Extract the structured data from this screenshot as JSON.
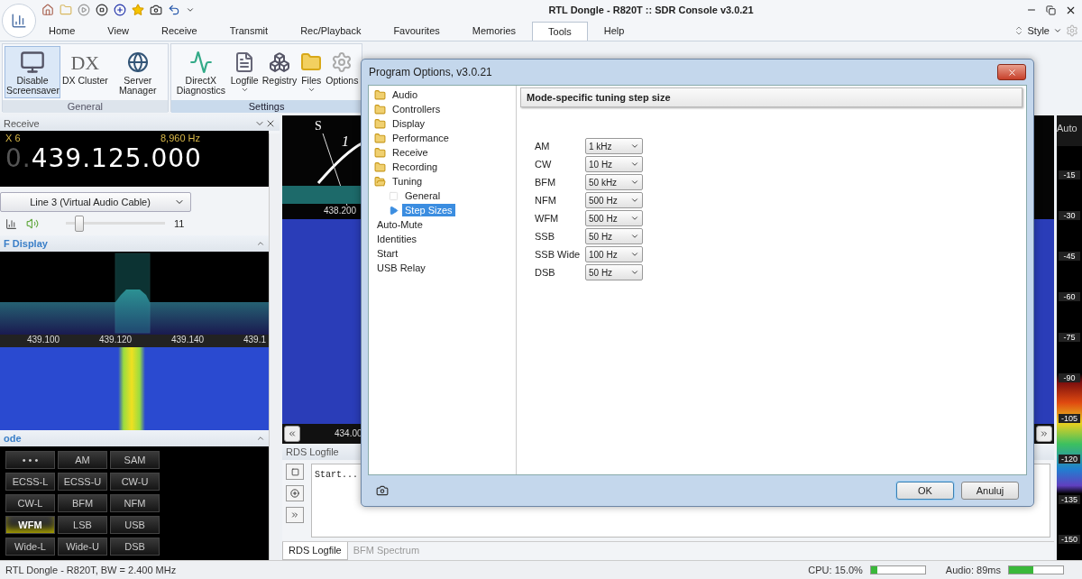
{
  "window": {
    "title": "RTL Dongle - R820T :: SDR Console v3.0.21"
  },
  "ribbon": {
    "tabs": [
      {
        "label": "Home",
        "selected": false
      },
      {
        "label": "View",
        "selected": false
      },
      {
        "label": "Receive",
        "selected": false
      },
      {
        "label": "Transmit",
        "selected": false
      },
      {
        "label": "Rec/Playback",
        "selected": false
      },
      {
        "label": "Favourites",
        "selected": false
      },
      {
        "label": "Memories",
        "selected": false
      },
      {
        "label": "Tools",
        "selected": true
      },
      {
        "label": "Help",
        "selected": false
      }
    ],
    "style_label": "Style",
    "groups": [
      {
        "title": "General",
        "buttons": [
          {
            "kind": "monitor",
            "label": "Disable Screensaver",
            "selected": true,
            "menu": false
          },
          {
            "kind": "glyph",
            "glyph": "DX",
            "label": "DX Cluster",
            "selected": false,
            "menu": false
          },
          {
            "kind": "server",
            "label": "Server Manager",
            "selected": false,
            "menu": false
          }
        ]
      },
      {
        "title": "Settings",
        "buttons": [
          {
            "kind": "diagnostics",
            "label": "DirectX Diagnostics",
            "selected": false,
            "menu": false
          },
          {
            "kind": "log",
            "label": "Logfile",
            "selected": false,
            "menu": true
          },
          {
            "kind": "registry",
            "label": "Registry",
            "selected": false,
            "menu": false
          },
          {
            "kind": "folder",
            "label": "Files",
            "selected": false,
            "menu": true
          },
          {
            "kind": "gear",
            "label": "Options",
            "selected": false,
            "menu": false
          }
        ]
      }
    ]
  },
  "receive": {
    "title": "Receive",
    "rx": "X 6",
    "offset": "8,960 Hz",
    "frequency_dim": "0.",
    "frequency": "439.125.000",
    "audio_device": "Line 3 (Virtual Audio Cable)",
    "volume": {
      "level": 0.1,
      "reading": "11"
    },
    "display_title": "F Display",
    "axis": [
      "439.100",
      "439.120",
      "439.140",
      "439.1"
    ],
    "mode_title": "ode",
    "modes": [
      {
        "label": "• • •",
        "selected": false
      },
      {
        "label": "AM",
        "selected": false
      },
      {
        "label": "SAM",
        "selected": false
      },
      {
        "label": "ECSS-L",
        "selected": false
      },
      {
        "label": "ECSS-U",
        "selected": false
      },
      {
        "label": "CW-U",
        "selected": false
      },
      {
        "label": "CW-L",
        "selected": false
      },
      {
        "label": "BFM",
        "selected": false
      },
      {
        "label": "NFM",
        "selected": false
      },
      {
        "label": "WFM",
        "selected": true
      },
      {
        "label": "LSB",
        "selected": false
      },
      {
        "label": "USB",
        "selected": false
      },
      {
        "label": "Wide-L",
        "selected": false
      },
      {
        "label": "Wide-U",
        "selected": false
      },
      {
        "label": "DSB",
        "selected": false
      }
    ]
  },
  "center": {
    "meter_s": "S",
    "meter_1": "1",
    "top_axis": "438.200",
    "bottom_axis": "434.00",
    "rds": {
      "title": "RDS Logfile",
      "log": "Start...",
      "tabs": [
        {
          "label": "RDS Logfile",
          "selected": true
        },
        {
          "label": "BFM Spectrum",
          "selected": false
        }
      ]
    }
  },
  "scale": {
    "mode": "Auto",
    "ticks": [
      "-15",
      "-30",
      "-45",
      "-60",
      "-75",
      "-90",
      "-105",
      "-120",
      "-135",
      "-150"
    ]
  },
  "status_bar": {
    "device": "RTL Dongle - R820T, BW = 2.400 MHz",
    "cpu": {
      "label": "CPU: 15.0%",
      "level": 0.12
    },
    "audio": {
      "label": "Audio: 89ms",
      "level": 0.45
    }
  },
  "dialog": {
    "title": "Program Options, v3.0.21",
    "tree": [
      {
        "kind": "folder",
        "label": "Audio",
        "selected": false
      },
      {
        "kind": "folder",
        "label": "Controllers",
        "selected": false
      },
      {
        "kind": "folder",
        "label": "Display",
        "selected": false
      },
      {
        "kind": "folder",
        "label": "Performance",
        "selected": false
      },
      {
        "kind": "folder",
        "label": "Receive",
        "selected": false
      },
      {
        "kind": "folder",
        "label": "Recording",
        "selected": false
      },
      {
        "kind": "folder",
        "label": "Tuning",
        "selected": false,
        "expanded": true,
        "children": [
          {
            "kind": "page",
            "label": "General",
            "selected": false
          },
          {
            "kind": "page",
            "label": "Step Sizes",
            "selected": true
          }
        ]
      },
      {
        "kind": "leaf",
        "label": "Auto-Mute",
        "selected": false
      },
      {
        "kind": "leaf",
        "label": "Identities",
        "selected": false
      },
      {
        "kind": "leaf",
        "label": "Start",
        "selected": false
      },
      {
        "kind": "leaf",
        "label": "USB Relay",
        "selected": false
      }
    ],
    "heading": "Mode-specific tuning step size",
    "steps": [
      {
        "mode": "AM",
        "value": "1 kHz"
      },
      {
        "mode": "CW",
        "value": "10 Hz"
      },
      {
        "mode": "BFM",
        "value": "50 kHz"
      },
      {
        "mode": "NFM",
        "value": "500 Hz"
      },
      {
        "mode": "WFM",
        "value": "500 Hz"
      },
      {
        "mode": "SSB",
        "value": "50 Hz"
      },
      {
        "mode": "SSB Wide",
        "value": "100 Hz"
      },
      {
        "mode": "DSB",
        "value": "50 Hz"
      }
    ],
    "buttons": [
      {
        "label": "OK",
        "selected": true
      },
      {
        "label": "Anuluj",
        "selected": false
      }
    ]
  }
}
